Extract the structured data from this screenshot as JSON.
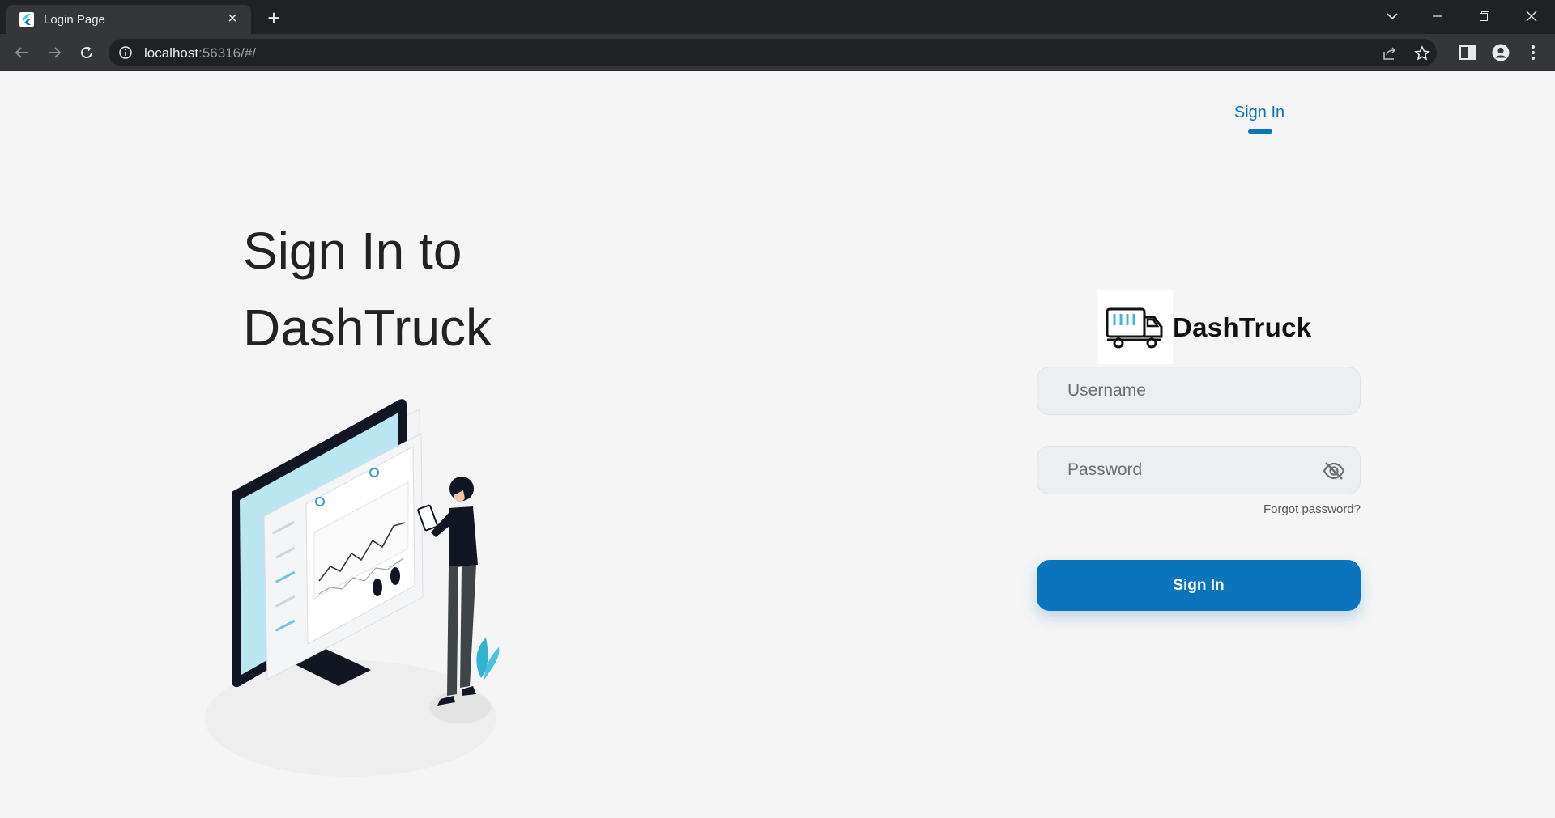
{
  "browser": {
    "tab_title": "Login Page",
    "tab_close": "×",
    "new_tab": "+",
    "url_host": "localhost",
    "url_rest": ":56316/#/"
  },
  "nav": {
    "tab_label": "Sign In"
  },
  "hero": {
    "line1": "Sign In to",
    "line2": "DashTruck"
  },
  "brand": {
    "name": "DashTruck"
  },
  "form": {
    "username_placeholder": "Username",
    "password_placeholder": "Password",
    "forgot_password": "Forgot password?",
    "submit_label": "Sign In"
  },
  "colors": {
    "accent": "#0a74bd",
    "page_bg": "#f5f5f5",
    "field_bg": "#eceff1"
  },
  "icons": {
    "password_toggle": "eye-off-icon",
    "logo": "truck-icon"
  }
}
